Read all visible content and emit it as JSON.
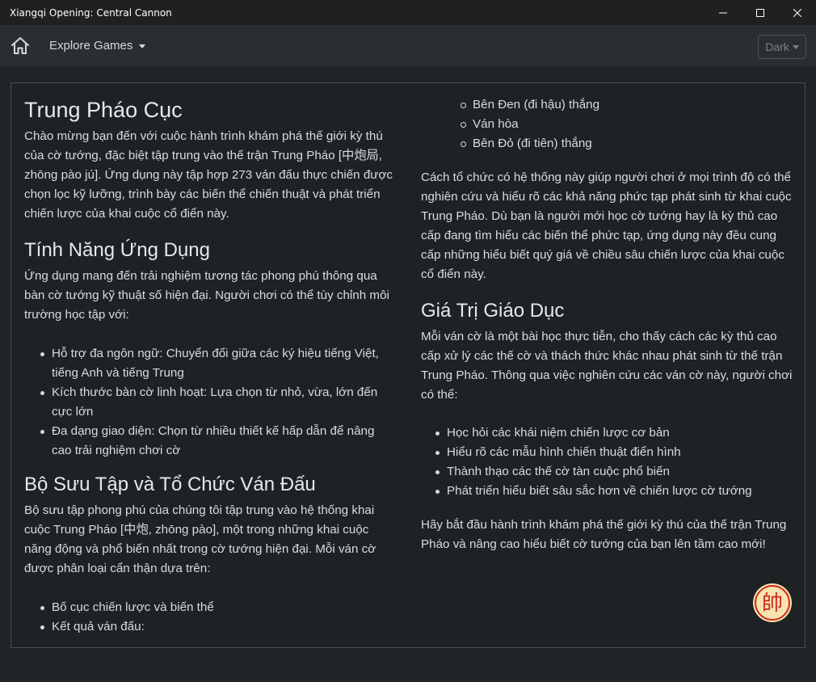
{
  "window": {
    "title": "Xiangqi Opening: Central Cannon"
  },
  "navbar": {
    "explore_label": "Explore Games",
    "theme_label": "Dark"
  },
  "badge": {
    "glyph": "帥"
  },
  "content": {
    "title": "Trung Pháo Cục",
    "intro": "Chào mừng bạn đến với cuộc hành trình khám phá thế giới kỳ thú của cờ tướng, đặc biệt tập trung vào thế trận Trung Pháo [中炮局, zhōng pào jú]. Ứng dụng này tập hợp 273 ván đấu thực chiến được chọn lọc kỹ lưỡng, trình bày các biến thể chiến thuật và phát triển chiến lược của khai cuộc cổ điển này.",
    "features_heading": "Tính Năng Ứng Dụng",
    "features_intro": "Ứng dụng mang đến trải nghiệm tương tác phong phú thông qua bàn cờ tướng kỹ thuật số hiện đại. Người chơi có thể tùy chỉnh môi trường học tập với:",
    "features": [
      "Hỗ trợ đa ngôn ngữ: Chuyển đổi giữa các ký hiệu tiếng Việt, tiếng Anh và tiếng Trung",
      "Kích thước bàn cờ linh hoạt: Lựa chọn từ nhỏ, vừa, lớn đến cực lớn",
      "Đa dạng giao diện: Chọn từ nhiều thiết kế hấp dẫn để nâng cao trải nghiệm chơi cờ"
    ],
    "collection_heading": "Bộ Sưu Tập và Tổ Chức Ván Đấu",
    "collection_intro": "Bộ sưu tập phong phú của chúng tôi tập trung vào hệ thống khai cuộc Trung Pháo [中炮, zhōng pào], một trong những khai cuộc năng động và phổ biến nhất trong cờ tướng hiện đại. Mỗi ván cờ được phân loại cẩn thận dựa trên:",
    "criteria": [
      "Bố cục chiến lược và biến thể",
      "Kết quả ván đấu:"
    ],
    "results": [
      "Bên Đen (đi hậu) thắng",
      "Ván hòa",
      "Bên Đỏ (đi tiên) thắng"
    ],
    "organization_text": "Cách tổ chức có hệ thống này giúp người chơi ở mọi trình độ có thể nghiên cứu và hiểu rõ các khả năng phức tạp phát sinh từ khai cuộc Trung Pháo. Dù bạn là người mới học cờ tướng hay là kỳ thủ cao cấp đang tìm hiểu các biến thể phức tạp, ứng dụng này đều cung cấp những hiểu biết quý giá về chiều sâu chiến lược của khai cuộc cổ điển này.",
    "education_heading": "Giá Trị Giáo Dục",
    "education_intro": "Mỗi ván cờ là một bài học thực tiễn, cho thấy cách các kỳ thủ cao cấp xử lý các thế cờ và thách thức khác nhau phát sinh từ thế trận Trung Pháo. Thông qua việc nghiên cứu các ván cờ này, người chơi có thể:",
    "education_items": [
      "Học hỏi các khái niệm chiến lược cơ bản",
      "Hiểu rõ các mẫu hình chiến thuật điển hình",
      "Thành thạo các thế cờ tàn cuộc phổ biến",
      "Phát triển hiểu biết sâu sắc hơn về chiến lược cờ tướng"
    ],
    "closing": "Hãy bắt đầu hành trình khám phá thế giới kỳ thú của thế trận Trung Pháo và nâng cao hiểu biết cờ tướng của bạn lên tầm cao mới!"
  }
}
